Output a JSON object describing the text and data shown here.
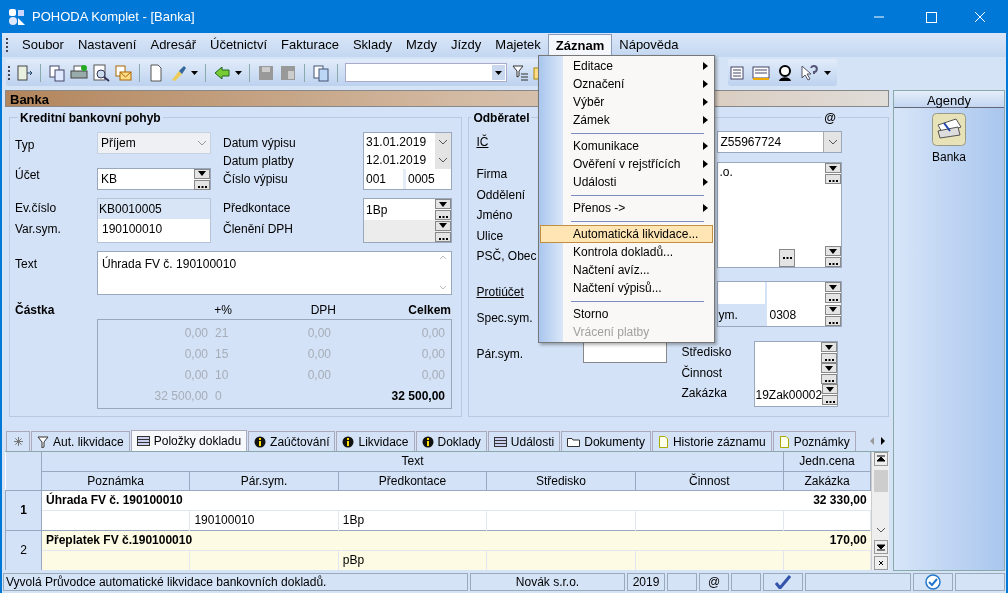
{
  "window": {
    "title": "POHODA Komplet - [Banka]"
  },
  "menu_bar": [
    {
      "label": "Soubor",
      "selected": false
    },
    {
      "label": "Nastavení",
      "selected": false
    },
    {
      "label": "Adresář",
      "selected": false
    },
    {
      "label": "Účetnictví",
      "selected": false
    },
    {
      "label": "Fakturace",
      "selected": false
    },
    {
      "label": "Sklady",
      "selected": false
    },
    {
      "label": "Mzdy",
      "selected": false
    },
    {
      "label": "Jízdy",
      "selected": false
    },
    {
      "label": "Majetek",
      "selected": false
    },
    {
      "label": "Záznam",
      "selected": true
    },
    {
      "label": "Nápověda",
      "selected": false
    }
  ],
  "dropdown": [
    {
      "kind": "item",
      "label": "Editace",
      "submenu": true,
      "selected": false,
      "disabled": false
    },
    {
      "kind": "item",
      "label": "Označení",
      "submenu": true,
      "selected": false,
      "disabled": false
    },
    {
      "kind": "item",
      "label": "Výběr",
      "submenu": true,
      "selected": false,
      "disabled": false
    },
    {
      "kind": "item",
      "label": "Zámek",
      "submenu": true,
      "selected": false,
      "disabled": false
    },
    {
      "kind": "separator"
    },
    {
      "kind": "item",
      "label": "Komunikace",
      "submenu": true,
      "selected": false,
      "disabled": false
    },
    {
      "kind": "item",
      "label": "Ověření v rejstřících",
      "submenu": true,
      "selected": false,
      "disabled": false
    },
    {
      "kind": "item",
      "label": "Události",
      "submenu": true,
      "selected": false,
      "disabled": false
    },
    {
      "kind": "separator"
    },
    {
      "kind": "item",
      "label": "Přenos ->",
      "submenu": true,
      "selected": false,
      "disabled": false
    },
    {
      "kind": "separator"
    },
    {
      "kind": "item",
      "label": "Automatická likvidace...",
      "submenu": false,
      "selected": true,
      "disabled": false
    },
    {
      "kind": "item",
      "label": "Kontrola dokladů...",
      "submenu": false,
      "selected": false,
      "disabled": false
    },
    {
      "kind": "item",
      "label": "Načtení avíz...",
      "submenu": false,
      "selected": false,
      "disabled": false
    },
    {
      "kind": "item",
      "label": "Načtení výpisů...",
      "submenu": false,
      "selected": false,
      "disabled": false
    },
    {
      "kind": "separator"
    },
    {
      "kind": "item",
      "label": "Storno",
      "submenu": false,
      "selected": false,
      "disabled": false
    },
    {
      "kind": "item",
      "label": "Vrácení platby",
      "submenu": false,
      "selected": false,
      "disabled": true
    }
  ],
  "agenda_header": "Banka",
  "form": {
    "title": "Kreditní bankovní pohyb",
    "typ": {
      "label": "Typ",
      "value": "Příjem"
    },
    "ucet": {
      "label": "Účet",
      "value": "KB"
    },
    "ev_cislo": {
      "label": "Ev.číslo",
      "value": "KB0010005"
    },
    "var_sym": {
      "label": "Var.sym.",
      "value": "190100010"
    },
    "datum_vypisu": {
      "label": "Datum výpisu",
      "value": "31.01.2019"
    },
    "datum_platby": {
      "label": "Datum platby",
      "value": "12.01.2019"
    },
    "cislo_vypisu": {
      "label": "Číslo výpisu",
      "values": [
        "001",
        "0005"
      ]
    },
    "predkontace": {
      "label": "Předkontace",
      "value": "1Bp"
    },
    "cleneni_dph": {
      "label": "Členění DPH"
    },
    "text": {
      "label": "Text",
      "value": "Úhrada FV č. 190100010"
    },
    "amounts": {
      "label": "Částka",
      "columns": [
        "+%",
        "DPH",
        "Celkem"
      ],
      "rows": [
        {
          "base": "0,00",
          "rate": "21",
          "vat": "0,00",
          "total": "0,00"
        },
        {
          "base": "0,00",
          "rate": "15",
          "vat": "0,00",
          "total": "0,00"
        },
        {
          "base": "0,00",
          "rate": "10",
          "vat": "0,00",
          "total": "0,00"
        },
        {
          "base": "32 500,00",
          "rate": "0",
          "total": "32 500,00"
        }
      ]
    }
  },
  "partner": {
    "title": "Odběratel",
    "at_sign": "@",
    "ic": {
      "label": "IČ",
      "value": "Z55967724"
    },
    "address_labels": [
      "Firma",
      "Oddělení",
      "Jméno",
      "Ulice",
      "PSČ, Obec"
    ],
    "address_value": ".o.",
    "protiucet": {
      "label": "Protiúčet"
    },
    "spec_sym": {
      "label": "Spec.sym.",
      "second_label": "ym.",
      "value": "0308"
    },
    "par_sym": {
      "label": "Pár.sym."
    },
    "stredisko": {
      "label": "Středisko"
    },
    "cinnost": {
      "label": "Činnost"
    },
    "zakazka": {
      "label": "Zakázka",
      "value": "19Zak00002"
    }
  },
  "agendy": {
    "title": "Agendy",
    "items": [
      {
        "label": "Banka"
      }
    ]
  },
  "tabs": [
    {
      "label": "Aut. likvidace",
      "selected": false
    },
    {
      "label": "Položky dokladu",
      "selected": true
    },
    {
      "label": "Zaúčtování",
      "selected": false
    },
    {
      "label": "Likvidace",
      "selected": false
    },
    {
      "label": "Doklady",
      "selected": false
    },
    {
      "label": "Události",
      "selected": false
    },
    {
      "label": "Dokumenty",
      "selected": false
    },
    {
      "label": "Historie záznamu",
      "selected": false
    },
    {
      "label": "Poznámky",
      "selected": false
    }
  ],
  "table": {
    "group_headers": [
      "Text",
      "Jedn.cena"
    ],
    "columns": [
      "Poznámka",
      "Pár.sym.",
      "Předkontace",
      "Středisko",
      "Činnost",
      "Zakázka"
    ],
    "rows": [
      {
        "number": "1",
        "text": "Úhrada FV č. 190100010",
        "unit_price": "32 330,00",
        "par_sym": "190100010",
        "predkontace": "1Bp",
        "selected": false
      },
      {
        "number": "2",
        "text": "Přeplatek FV č.190100010",
        "unit_price": "170,00",
        "predkontace": "pBp",
        "selected": true
      }
    ]
  },
  "status_bar": {
    "message": "Vyvolá Průvodce automatické likvidace bankovních dokladů.",
    "company": "Novák s.r.o.",
    "year": "2019",
    "at_sign": "@"
  }
}
